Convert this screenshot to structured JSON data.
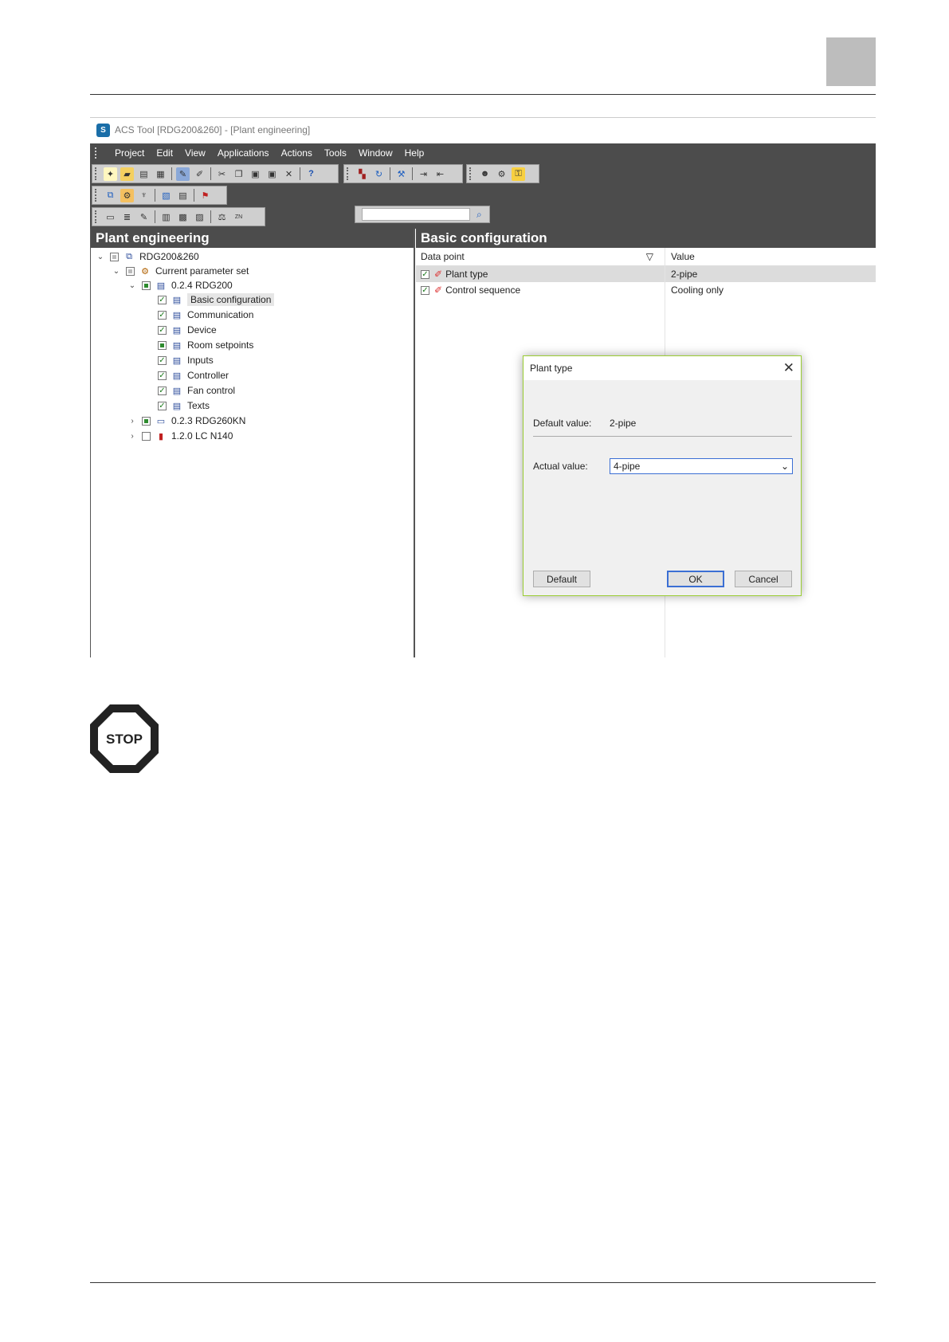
{
  "app": {
    "window_title": "ACS Tool [RDG200&260] - [Plant engineering]",
    "icon_letter": "S"
  },
  "menu": [
    "Project",
    "Edit",
    "View",
    "Applications",
    "Actions",
    "Tools",
    "Window",
    "Help"
  ],
  "search": {
    "placeholder": ""
  },
  "left_pane": {
    "title": "Plant engineering",
    "tree": [
      {
        "label": "RDG200&260"
      },
      {
        "label": "Current parameter set"
      },
      {
        "label": "0.2.4 RDG200"
      },
      {
        "label": "Basic configuration"
      },
      {
        "label": "Communication"
      },
      {
        "label": "Device"
      },
      {
        "label": "Room setpoints"
      },
      {
        "label": "Inputs"
      },
      {
        "label": "Controller"
      },
      {
        "label": "Fan control"
      },
      {
        "label": "Texts"
      },
      {
        "label": "0.2.3  RDG260KN"
      },
      {
        "label": "1.2.0  LC N140"
      }
    ]
  },
  "right_pane": {
    "title": "Basic configuration",
    "columns": [
      "Data point",
      "Value"
    ],
    "rows": [
      {
        "data_point": "Plant type",
        "value": "2-pipe"
      },
      {
        "data_point": "Control sequence",
        "value": "Cooling only"
      }
    ]
  },
  "dialog": {
    "title": "Plant type",
    "default_label": "Default value:",
    "default_value": "2-pipe",
    "actual_label": "Actual value:",
    "actual_value": "4-pipe",
    "buttons": {
      "default": "Default",
      "ok": "OK",
      "cancel": "Cancel"
    }
  },
  "stop_sign": {
    "text": "STOP"
  },
  "colors": {
    "toolbar_bg": "#4c4c4c",
    "accent": "#3b6fd4",
    "dialog_border": "#9acd32"
  }
}
